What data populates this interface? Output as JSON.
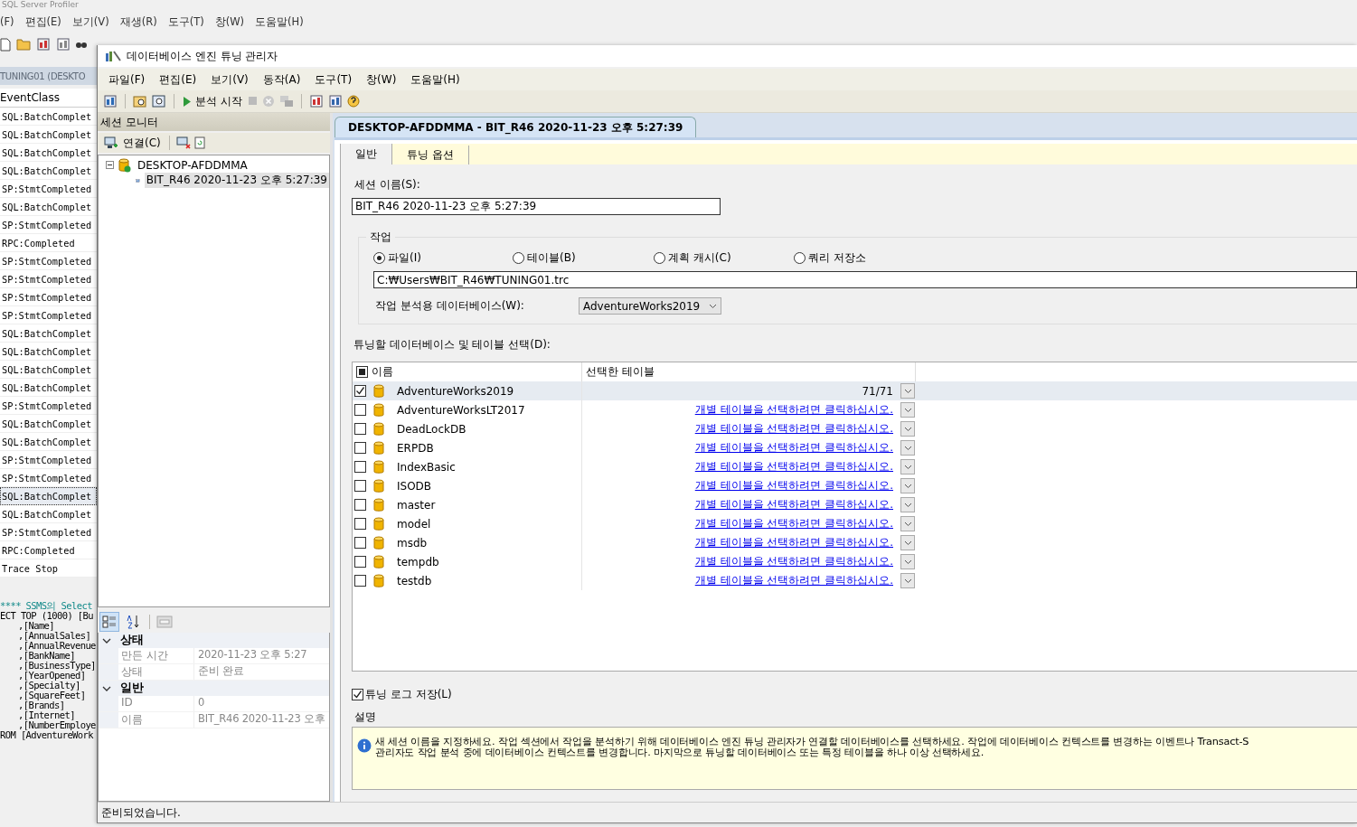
{
  "profiler": {
    "title": "SQL Server Profiler",
    "menu": [
      "(F)",
      "편집(E)",
      "보기(V)",
      "재생(R)",
      "도구(T)",
      "창(W)",
      "도움말(H)"
    ],
    "trace_tab": "TUNING01 (DESKTO",
    "column_header": "EventClass",
    "events": [
      {
        "text": "SQL:BatchComplet",
        "selected": false
      },
      {
        "text": "SQL:BatchComplet",
        "selected": false
      },
      {
        "text": "SQL:BatchComplet",
        "selected": false
      },
      {
        "text": "SQL:BatchComplet",
        "selected": false
      },
      {
        "text": "SP:StmtCompleted",
        "selected": false
      },
      {
        "text": "SQL:BatchComplet",
        "selected": false
      },
      {
        "text": "SP:StmtCompleted",
        "selected": false
      },
      {
        "text": "RPC:Completed",
        "selected": false
      },
      {
        "text": "SP:StmtCompleted",
        "selected": false
      },
      {
        "text": "SP:StmtCompleted",
        "selected": false
      },
      {
        "text": "SP:StmtCompleted",
        "selected": false
      },
      {
        "text": "SP:StmtCompleted",
        "selected": false
      },
      {
        "text": "SQL:BatchComplet",
        "selected": false
      },
      {
        "text": "SQL:BatchComplet",
        "selected": false
      },
      {
        "text": "SQL:BatchComplet",
        "selected": false
      },
      {
        "text": "SQL:BatchComplet",
        "selected": false
      },
      {
        "text": "SP:StmtCompleted",
        "selected": false
      },
      {
        "text": "SQL:BatchComplet",
        "selected": false
      },
      {
        "text": "SQL:BatchComplet",
        "selected": false
      },
      {
        "text": "SP:StmtCompleted",
        "selected": false
      },
      {
        "text": "SP:StmtCompleted",
        "selected": false
      },
      {
        "text": "SQL:BatchComplet",
        "selected": true
      },
      {
        "text": "SQL:BatchComplet",
        "selected": false
      },
      {
        "text": "SP:StmtCompleted",
        "selected": false
      },
      {
        "text": "RPC:Completed",
        "selected": false
      },
      {
        "text": "Trace Stop",
        "selected": false
      }
    ],
    "sql_lines": [
      {
        "kind": "comment",
        "text": "**** SSMS의 Select"
      },
      {
        "kind": "code",
        "text": "ECT TOP (1000) [Bu"
      },
      {
        "kind": "column",
        "text": ",[Name]"
      },
      {
        "kind": "column",
        "text": ",[AnnualSales]"
      },
      {
        "kind": "column",
        "text": ",[AnnualRevenue"
      },
      {
        "kind": "column",
        "text": ",[BankName]"
      },
      {
        "kind": "column",
        "text": ",[BusinessType]"
      },
      {
        "kind": "column",
        "text": ",[YearOpened]"
      },
      {
        "kind": "column",
        "text": ",[Specialty]"
      },
      {
        "kind": "column",
        "text": ",[SquareFeet]"
      },
      {
        "kind": "column",
        "text": ",[Brands]"
      },
      {
        "kind": "column",
        "text": ",[Internet]"
      },
      {
        "kind": "column",
        "text": ",[NumberEmploye"
      },
      {
        "kind": "code",
        "text": "ROM [AdventureWork"
      }
    ]
  },
  "window": {
    "title": "데이터베이스 엔진 튜닝 관리자",
    "menu": [
      "파일(F)",
      "편집(E)",
      "보기(V)",
      "동작(A)",
      "도구(T)",
      "창(W)",
      "도움말(H)"
    ],
    "start_analysis": "분석 시작"
  },
  "session_monitor": {
    "title": "세션 모니터",
    "connect": "연결(C)",
    "tree": [
      {
        "label": "DESKTOP-AFDDMMA",
        "expanded": true,
        "selected": false,
        "children": [
          {
            "label": "BIT_R46 2020-11-23 오후 5:27:39",
            "selected": true
          }
        ]
      }
    ]
  },
  "properties": {
    "categorized": true,
    "categories": [
      {
        "name": "상태",
        "expanded": true,
        "rows": [
          {
            "name": "만든 시간",
            "value": "2020-11-23 오후 5:27"
          },
          {
            "name": "상태",
            "value": "준비 완료"
          }
        ]
      },
      {
        "name": "일반",
        "expanded": true,
        "rows": [
          {
            "name": "ID",
            "value": "0"
          },
          {
            "name": "이름",
            "value": "BIT_R46 2020-11-23 오후"
          }
        ]
      }
    ]
  },
  "document_tab": "DESKTOP-AFDDMMA - BIT_R46 2020-11-23 오후 5:27:39",
  "tabs": [
    {
      "label": "일반",
      "selected": true
    },
    {
      "label": "튜닝 옵션",
      "selected": false
    }
  ],
  "session_name": {
    "label": "세션 이름(S):",
    "value": "BIT_R46 2020-11-23 오후 5:27:39"
  },
  "workload": {
    "title": "작업",
    "options": [
      {
        "label": "파일(I)",
        "selected": true
      },
      {
        "label": "테이블(B)",
        "selected": false
      },
      {
        "label": "계획 캐시(C)",
        "selected": false
      },
      {
        "label": "쿼리 저장소",
        "selected": false
      }
    ],
    "path": "C:₩Users₩BIT_R46₩TUNING01.trc",
    "database_label": "작업 분석용 데이터베이스(W):",
    "database": "AdventureWorks2019"
  },
  "databases": {
    "label": "튜닝할 데이터베이스 및 테이블 선택(D):",
    "columns": [
      "이름",
      "선택한 테이블"
    ],
    "header_partial": true,
    "rows": [
      {
        "name": "AdventureWorks2019",
        "checked": true,
        "selected": true,
        "kind": "count",
        "tables": "71/71"
      },
      {
        "name": "AdventureWorksLT2017",
        "checked": false,
        "selected": false,
        "kind": "link",
        "tables": "개별 테이블을 선택하려면 클릭하십시오."
      },
      {
        "name": "DeadLockDB",
        "checked": false,
        "selected": false,
        "kind": "link",
        "tables": "개별 테이블을 선택하려면 클릭하십시오."
      },
      {
        "name": "ERPDB",
        "checked": false,
        "selected": false,
        "kind": "link",
        "tables": "개별 테이블을 선택하려면 클릭하십시오."
      },
      {
        "name": "IndexBasic",
        "checked": false,
        "selected": false,
        "kind": "link",
        "tables": "개별 테이블을 선택하려면 클릭하십시오."
      },
      {
        "name": "ISODB",
        "checked": false,
        "selected": false,
        "kind": "link",
        "tables": "개별 테이블을 선택하려면 클릭하십시오."
      },
      {
        "name": "master",
        "checked": false,
        "selected": false,
        "kind": "link",
        "tables": "개별 테이블을 선택하려면 클릭하십시오."
      },
      {
        "name": "model",
        "checked": false,
        "selected": false,
        "kind": "link",
        "tables": "개별 테이블을 선택하려면 클릭하십시오."
      },
      {
        "name": "msdb",
        "checked": false,
        "selected": false,
        "kind": "link",
        "tables": "개별 테이블을 선택하려면 클릭하십시오."
      },
      {
        "name": "tempdb",
        "checked": false,
        "selected": false,
        "kind": "link",
        "tables": "개별 테이블을 선택하려면 클릭하십시오."
      },
      {
        "name": "testdb",
        "checked": false,
        "selected": false,
        "kind": "link",
        "tables": "개별 테이블을 선택하려면 클릭하십시오."
      }
    ]
  },
  "save_log": {
    "label": "튜닝 로그 저장(L)",
    "checked": true
  },
  "description": {
    "title": "설명",
    "lines": [
      "새 세션 이름을 지정하세요. 작업 섹션에서 작업을 분석하기 위해 데이터베이스 엔진 튜닝 관리자가 연결할 데이터베이스를 선택하세요. 작업에 데이터베이스 컨텍스트를 변경하는 이벤트나 Transact-S",
      "관리자도 작업 분석 중에 데이터베이스 컨텍스트를 변경합니다. 마지막으로 튜닝할 데이터베이스 또는 특정 테이블을 하나 이상 선택하세요."
    ]
  },
  "status_bar": "준비되었습니다."
}
